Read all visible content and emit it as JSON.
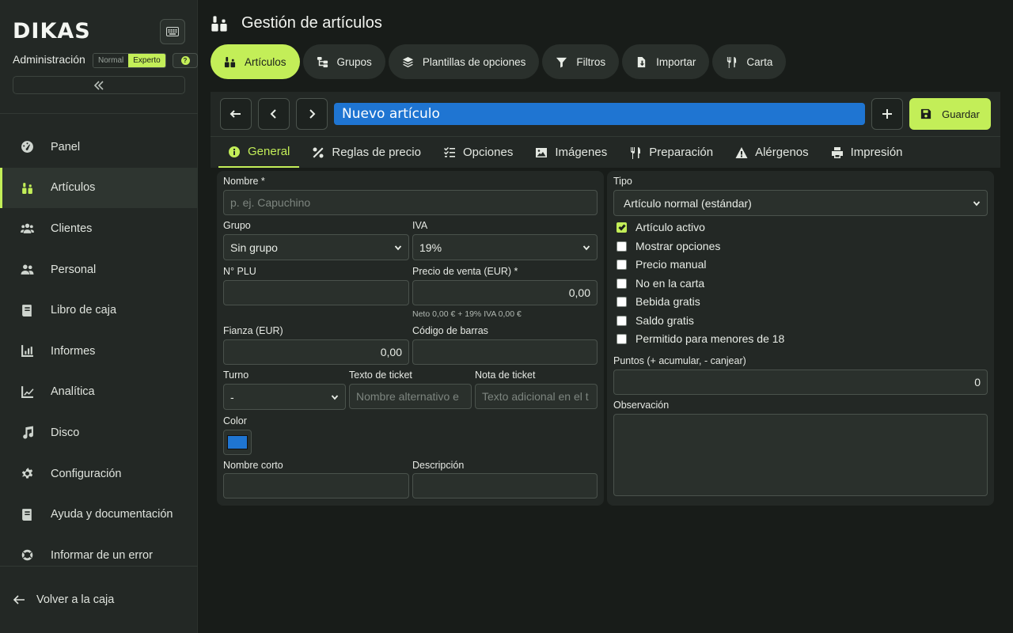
{
  "sidebar": {
    "logo": "DIKAS",
    "admin_label": "Administración",
    "mode_normal": "Normal",
    "mode_expert": "Experto",
    "items": [
      {
        "label": "Panel",
        "icon": "dashboard-icon"
      },
      {
        "label": "Artículos",
        "icon": "articles-icon",
        "active": true
      },
      {
        "label": "Clientes",
        "icon": "customers-icon"
      },
      {
        "label": "Personal",
        "icon": "staff-icon"
      },
      {
        "label": "Libro de caja",
        "icon": "cashbook-icon"
      },
      {
        "label": "Informes",
        "icon": "reports-icon"
      },
      {
        "label": "Analítica",
        "icon": "analytics-icon"
      },
      {
        "label": "Disco",
        "icon": "music-icon"
      },
      {
        "label": "Configuración",
        "icon": "gear-icon"
      },
      {
        "label": "Ayuda y documentación",
        "icon": "book-icon"
      },
      {
        "label": "Informar de un error",
        "icon": "lifebuoy-icon"
      }
    ],
    "back_label": "Volver a la caja"
  },
  "header": {
    "title": "Gestión de artículos",
    "tabs": [
      {
        "label": "Artículos",
        "active": true
      },
      {
        "label": "Grupos"
      },
      {
        "label": "Plantillas de opciones"
      },
      {
        "label": "Filtros"
      },
      {
        "label": "Importar"
      },
      {
        "label": "Carta"
      }
    ]
  },
  "editor": {
    "title_value": "Nuevo artículo",
    "save_label": "Guardar",
    "subtabs": [
      {
        "label": "General",
        "active": true
      },
      {
        "label": "Reglas de precio"
      },
      {
        "label": "Opciones"
      },
      {
        "label": "Imágenes"
      },
      {
        "label": "Preparación"
      },
      {
        "label": "Alérgenos"
      },
      {
        "label": "Impresión"
      }
    ]
  },
  "form": {
    "nombre_label": "Nombre *",
    "nombre_placeholder": "p. ej. Capuchino",
    "grupo_label": "Grupo",
    "grupo_value": "Sin grupo",
    "iva_label": "IVA",
    "iva_value": "19%",
    "plu_label": "N° PLU",
    "plu_value": "",
    "precio_label": "Precio de venta (EUR) *",
    "precio_value": "0,00",
    "precio_hint": "Neto 0,00 € + 19% IVA 0,00 €",
    "fianza_label": "Fianza (EUR)",
    "fianza_value": "0,00",
    "barcode_label": "Código de barras",
    "barcode_value": "",
    "turno_label": "Turno",
    "turno_value": "-",
    "ticket_text_label": "Texto de ticket",
    "ticket_text_placeholder": "Nombre alternativo e",
    "ticket_note_label": "Nota de ticket",
    "ticket_note_placeholder": "Texto adicional en el t",
    "color_label": "Color",
    "color_value": "#1f75d2",
    "short_name_label": "Nombre corto",
    "short_name_value": "",
    "description_label": "Descripción",
    "description_value": ""
  },
  "right": {
    "tipo_label": "Tipo",
    "tipo_value": "Artículo normal (estándar)",
    "checks": [
      {
        "label": "Artículo activo",
        "checked": true
      },
      {
        "label": "Mostrar opciones",
        "checked": false
      },
      {
        "label": "Precio manual",
        "checked": false
      },
      {
        "label": "No en la carta",
        "checked": false
      },
      {
        "label": "Bebida gratis",
        "checked": false
      },
      {
        "label": "Saldo gratis",
        "checked": false
      },
      {
        "label": "Permitido para menores de 18",
        "checked": false
      }
    ],
    "points_label": "Puntos (+ acumular, - canjear)",
    "points_value": "0",
    "observation_label": "Observación",
    "observation_value": ""
  },
  "colors": {
    "accent": "#c3ee58",
    "title_blue": "#1f75d2",
    "background": "#181c19",
    "panel": "#232825"
  }
}
